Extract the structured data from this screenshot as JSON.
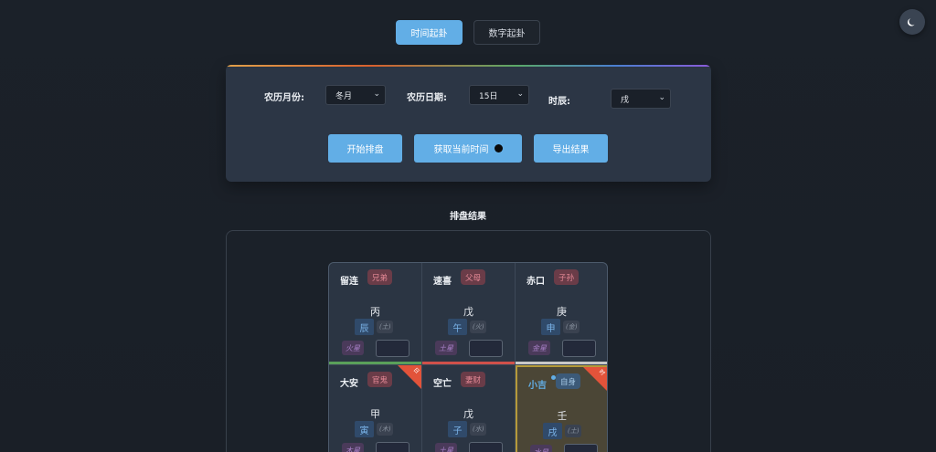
{
  "tabs": [
    {
      "label": "时间起卦",
      "active": true
    },
    {
      "label": "数字起卦",
      "active": false
    }
  ],
  "theme_toggle": {
    "icon": "moon-icon"
  },
  "form": {
    "month_label": "农历月份:",
    "month_value": "冬月",
    "date_label": "农历日期:",
    "date_value": "15日",
    "hour_label": "时辰:",
    "hour_value": "戌",
    "start_button": "开始排盘",
    "now_button": "获取当前时间",
    "export_button": "导出结果"
  },
  "result": {
    "title": "排盘结果",
    "cells": [
      {
        "name": "留连",
        "relation": "兄弟",
        "rel_style": "red",
        "stem": "丙",
        "branch": "辰",
        "element": "(土)",
        "star": "火星",
        "bar_color": "#5aa05a",
        "corner": ""
      },
      {
        "name": "速喜",
        "relation": "父母",
        "rel_style": "red",
        "stem": "戊",
        "branch": "午",
        "element": "(火)",
        "star": "土星",
        "bar_color": "#d0504a",
        "corner": ""
      },
      {
        "name": "赤口",
        "relation": "子孙",
        "rel_style": "red",
        "stem": "庚",
        "branch": "申",
        "element": "(金)",
        "star": "金星",
        "bar_color": "#c8c8c8",
        "corner": ""
      },
      {
        "name": "大安",
        "relation": "官鬼",
        "rel_style": "red",
        "stem": "甲",
        "branch": "寅",
        "element": "(木)",
        "star": "木星",
        "bar_color": "",
        "corner": "日"
      },
      {
        "name": "空亡",
        "relation": "妻财",
        "rel_style": "red",
        "stem": "戊",
        "branch": "子",
        "element": "(水)",
        "star": "土星",
        "bar_color": "",
        "corner": ""
      },
      {
        "name": "小吉",
        "relation": "自身",
        "rel_style": "blue",
        "stem": "壬",
        "branch": "戌",
        "element": "(土)",
        "star": "水星",
        "bar_color": "",
        "corner": "时",
        "highlight": true
      }
    ]
  }
}
